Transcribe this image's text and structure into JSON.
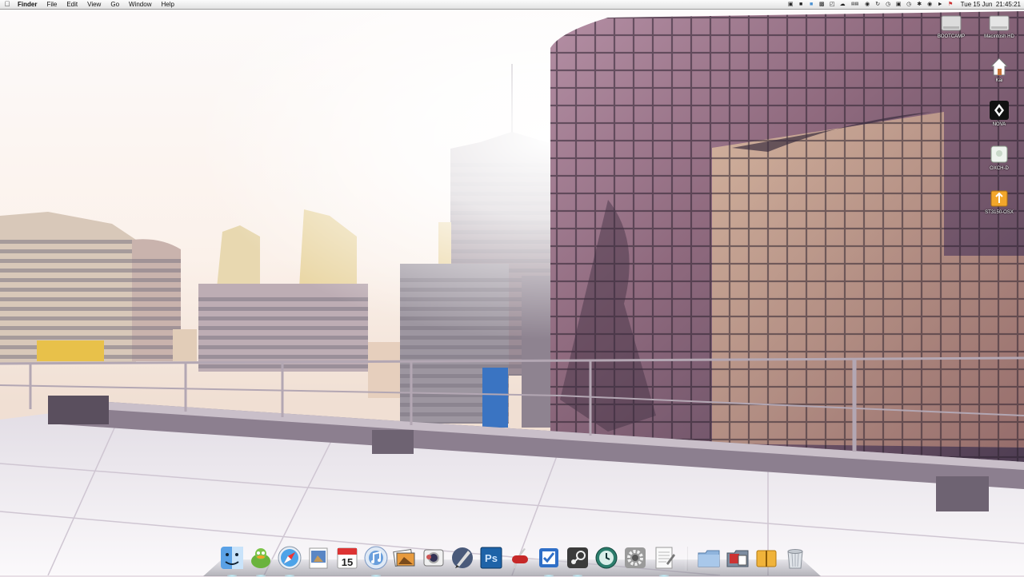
{
  "menubar": {
    "app_name": "Finder",
    "menus": [
      "File",
      "Edit",
      "View",
      "Go",
      "Window",
      "Help"
    ],
    "status_icons": [
      "screen-sharing-icon",
      "app-icon",
      "app-icon",
      "app-icon",
      "app-icon",
      "cloud-icon",
      "cpu-meter-icon",
      "growl-icon",
      "sync-icon",
      "time-machine-icon",
      "lock-icon",
      "clock-icon",
      "bluetooth-icon",
      "wifi-icon",
      "volume-icon",
      "flag-icon"
    ],
    "clock": "Tue 15 Jun  21:45:21"
  },
  "desktop_icons": [
    {
      "label": "BOOTCAMP",
      "icon": "hard-drive-icon"
    },
    {
      "label": "Macintosh HD",
      "icon": "hard-drive-icon"
    },
    {
      "label": "Kai",
      "icon": "home-folder-icon"
    },
    {
      "label": "NOVA",
      "icon": "disk-image-icon"
    },
    {
      "label": "OXCH-D",
      "icon": "external-drive-icon"
    },
    {
      "label": "ST3150-OSX",
      "icon": "usb-drive-icon"
    }
  ],
  "dock": {
    "apps": [
      {
        "name": "Finder",
        "icon": "finder-icon",
        "running": true
      },
      {
        "name": "Adium",
        "icon": "adium-duck-icon",
        "running": true
      },
      {
        "name": "Safari",
        "icon": "safari-compass-icon",
        "running": true
      },
      {
        "name": "Preview",
        "icon": "preview-icon",
        "running": false
      },
      {
        "name": "iCal",
        "icon": "calendar-icon",
        "running": false,
        "badge": "15"
      },
      {
        "name": "iTunes",
        "icon": "itunes-icon",
        "running": true
      },
      {
        "name": "iPhoto",
        "icon": "iphoto-icon",
        "running": false
      },
      {
        "name": "Photo Booth",
        "icon": "photo-booth-icon",
        "running": false
      },
      {
        "name": "Pixelmator",
        "icon": "pen-brush-icon",
        "running": false
      },
      {
        "name": "Photoshop",
        "icon": "photoshop-icon",
        "running": false,
        "badge": "Ps"
      },
      {
        "name": "Tool",
        "icon": "swiss-knife-icon",
        "running": false
      },
      {
        "name": "Things",
        "icon": "checkbox-icon",
        "running": true
      },
      {
        "name": "Steam",
        "icon": "steam-icon",
        "running": true
      },
      {
        "name": "Time Machine",
        "icon": "time-machine-icon",
        "running": false
      },
      {
        "name": "System Preferences",
        "icon": "gear-icon",
        "running": false
      },
      {
        "name": "TextEdit",
        "icon": "document-icon",
        "running": true
      }
    ],
    "stacks": [
      {
        "name": "Documents",
        "icon": "folder-icon"
      },
      {
        "name": "Downloads",
        "icon": "downloads-folder-icon"
      },
      {
        "name": "Applications",
        "icon": "applications-folder-icon"
      },
      {
        "name": "Trash",
        "icon": "trash-icon"
      }
    ]
  },
  "colors": {
    "sky_top": "#ffffff",
    "sky_haze": "#f3e3d8",
    "building_purple": "#5d4760",
    "glass_warm": "#c79a82",
    "rooftop": "#f4f0f4",
    "dock_lamp": "#bff4ff"
  }
}
